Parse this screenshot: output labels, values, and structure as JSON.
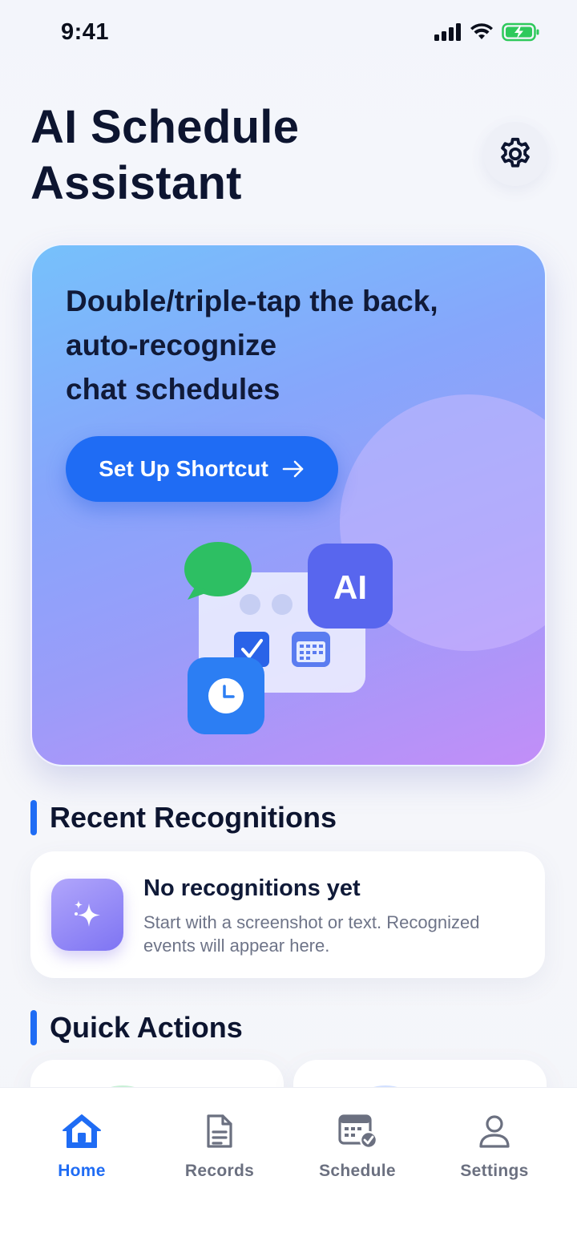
{
  "status_bar": {
    "time": "9:41"
  },
  "header": {
    "title": "AI Schedule Assistant"
  },
  "hero": {
    "headline_lines": [
      "Double/triple-tap the back,",
      "auto-recognize",
      "chat schedules"
    ],
    "cta_label": "Set Up Shortcut",
    "ai_badge": "AI"
  },
  "recent": {
    "section_title": "Recent Recognitions",
    "empty_title": "No recognitions yet",
    "empty_subtitle": "Start with a screenshot or text. Recognized events will appear here."
  },
  "quick_actions": {
    "section_title": "Quick Actions"
  },
  "tabs": [
    {
      "label": "Home",
      "icon": "home-icon",
      "active": true
    },
    {
      "label": "Records",
      "icon": "document-icon",
      "active": false
    },
    {
      "label": "Schedule",
      "icon": "calendar-check-icon",
      "active": false
    },
    {
      "label": "Settings",
      "icon": "person-icon",
      "active": false
    }
  ],
  "colors": {
    "accent": "#1f6cf4",
    "title": "#0d1530",
    "muted": "#6b7080"
  }
}
